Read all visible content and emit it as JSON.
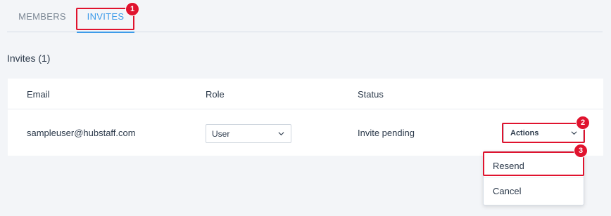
{
  "tabs": [
    {
      "label": "MEMBERS",
      "active": false
    },
    {
      "label": "INVITES",
      "active": true
    }
  ],
  "section": {
    "title": "Invites (1)"
  },
  "table": {
    "headers": {
      "email": "Email",
      "role": "Role",
      "status": "Status"
    },
    "rows": [
      {
        "email": "sampleuser@hubstaff.com",
        "role": "User",
        "status": "Invite pending",
        "actions_label": "Actions"
      }
    ]
  },
  "actions_menu": {
    "items": [
      {
        "label": "Resend"
      },
      {
        "label": "Cancel"
      }
    ]
  },
  "annotations": {
    "badge_1": "1",
    "badge_2": "2",
    "badge_3": "3"
  },
  "colors": {
    "accent": "#3d9be9",
    "annotation": "#e0132e",
    "background": "#f3f5f8"
  },
  "icons": {
    "role_select": "chevron-down-icon",
    "actions": "chevron-down-icon"
  }
}
